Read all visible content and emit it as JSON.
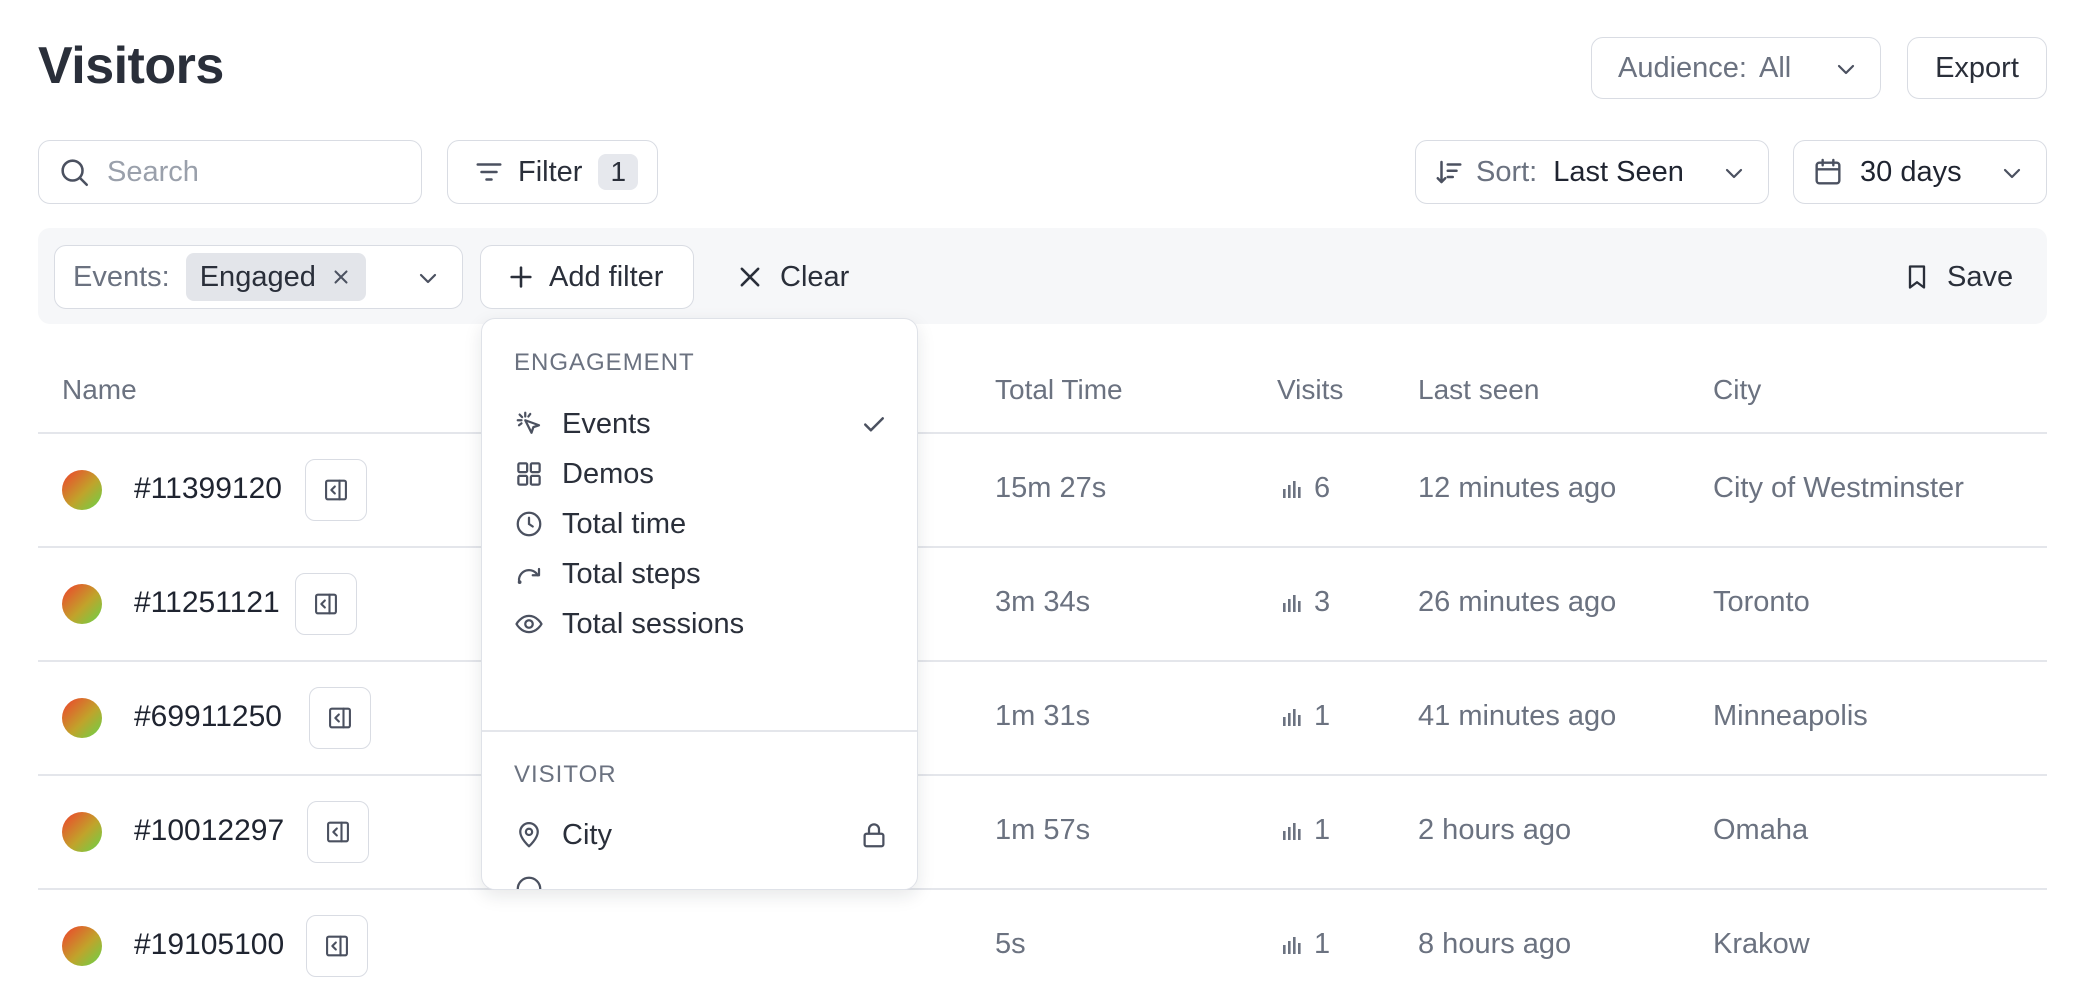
{
  "page": {
    "title": "Visitors"
  },
  "toolbar": {
    "audience_label": "Audience:",
    "audience_value": "All",
    "export_label": "Export",
    "search_placeholder": "Search",
    "filter_label": "Filter",
    "filter_count": "1",
    "sort_label": "Sort:",
    "sort_value": "Last Seen",
    "range_value": "30 days"
  },
  "filterbar": {
    "events_label": "Events:",
    "events_chip": "Engaged",
    "add_filter_label": "Add filter",
    "clear_label": "Clear",
    "save_label": "Save"
  },
  "table": {
    "columns": {
      "name": "Name",
      "total_time": "Total Time",
      "visits": "Visits",
      "last_seen": "Last seen",
      "city": "City"
    },
    "rows": [
      {
        "name": "#11399120",
        "total_time": "15m 27s",
        "visits": "6",
        "last_seen": "12 minutes ago",
        "city": "City of Westminster"
      },
      {
        "name": "#11251121",
        "total_time": "3m 34s",
        "visits": "3",
        "last_seen": "26 minutes ago",
        "city": "Toronto"
      },
      {
        "name": "#69911250",
        "total_time": "1m 31s",
        "visits": "1",
        "last_seen": "41 minutes ago",
        "city": "Minneapolis"
      },
      {
        "name": "#10012297",
        "total_time": "1m 57s",
        "visits": "1",
        "last_seen": "2 hours ago",
        "city": "Omaha"
      },
      {
        "name": "#19105100",
        "total_time": "5s",
        "visits": "1",
        "last_seen": "8 hours ago",
        "city": "Krakow"
      }
    ]
  },
  "dropdown": {
    "section_engagement": "ENGAGEMENT",
    "items_engagement": [
      {
        "label": "Events",
        "icon": "cursor-click-icon",
        "selected": true
      },
      {
        "label": "Demos",
        "icon": "grid-icon"
      },
      {
        "label": "Total time",
        "icon": "clock-icon"
      },
      {
        "label": "Total steps",
        "icon": "redo-arrow-icon"
      },
      {
        "label": "Total sessions",
        "icon": "eye-icon"
      }
    ],
    "section_visitor": "VISITOR",
    "items_visitor": [
      {
        "label": "City",
        "icon": "map-pin-icon",
        "locked": true
      }
    ]
  },
  "colors": {
    "text": "#1f2430",
    "muted": "#6b7280",
    "border": "#d9dce3",
    "filterbar_bg": "#f6f7f9"
  }
}
